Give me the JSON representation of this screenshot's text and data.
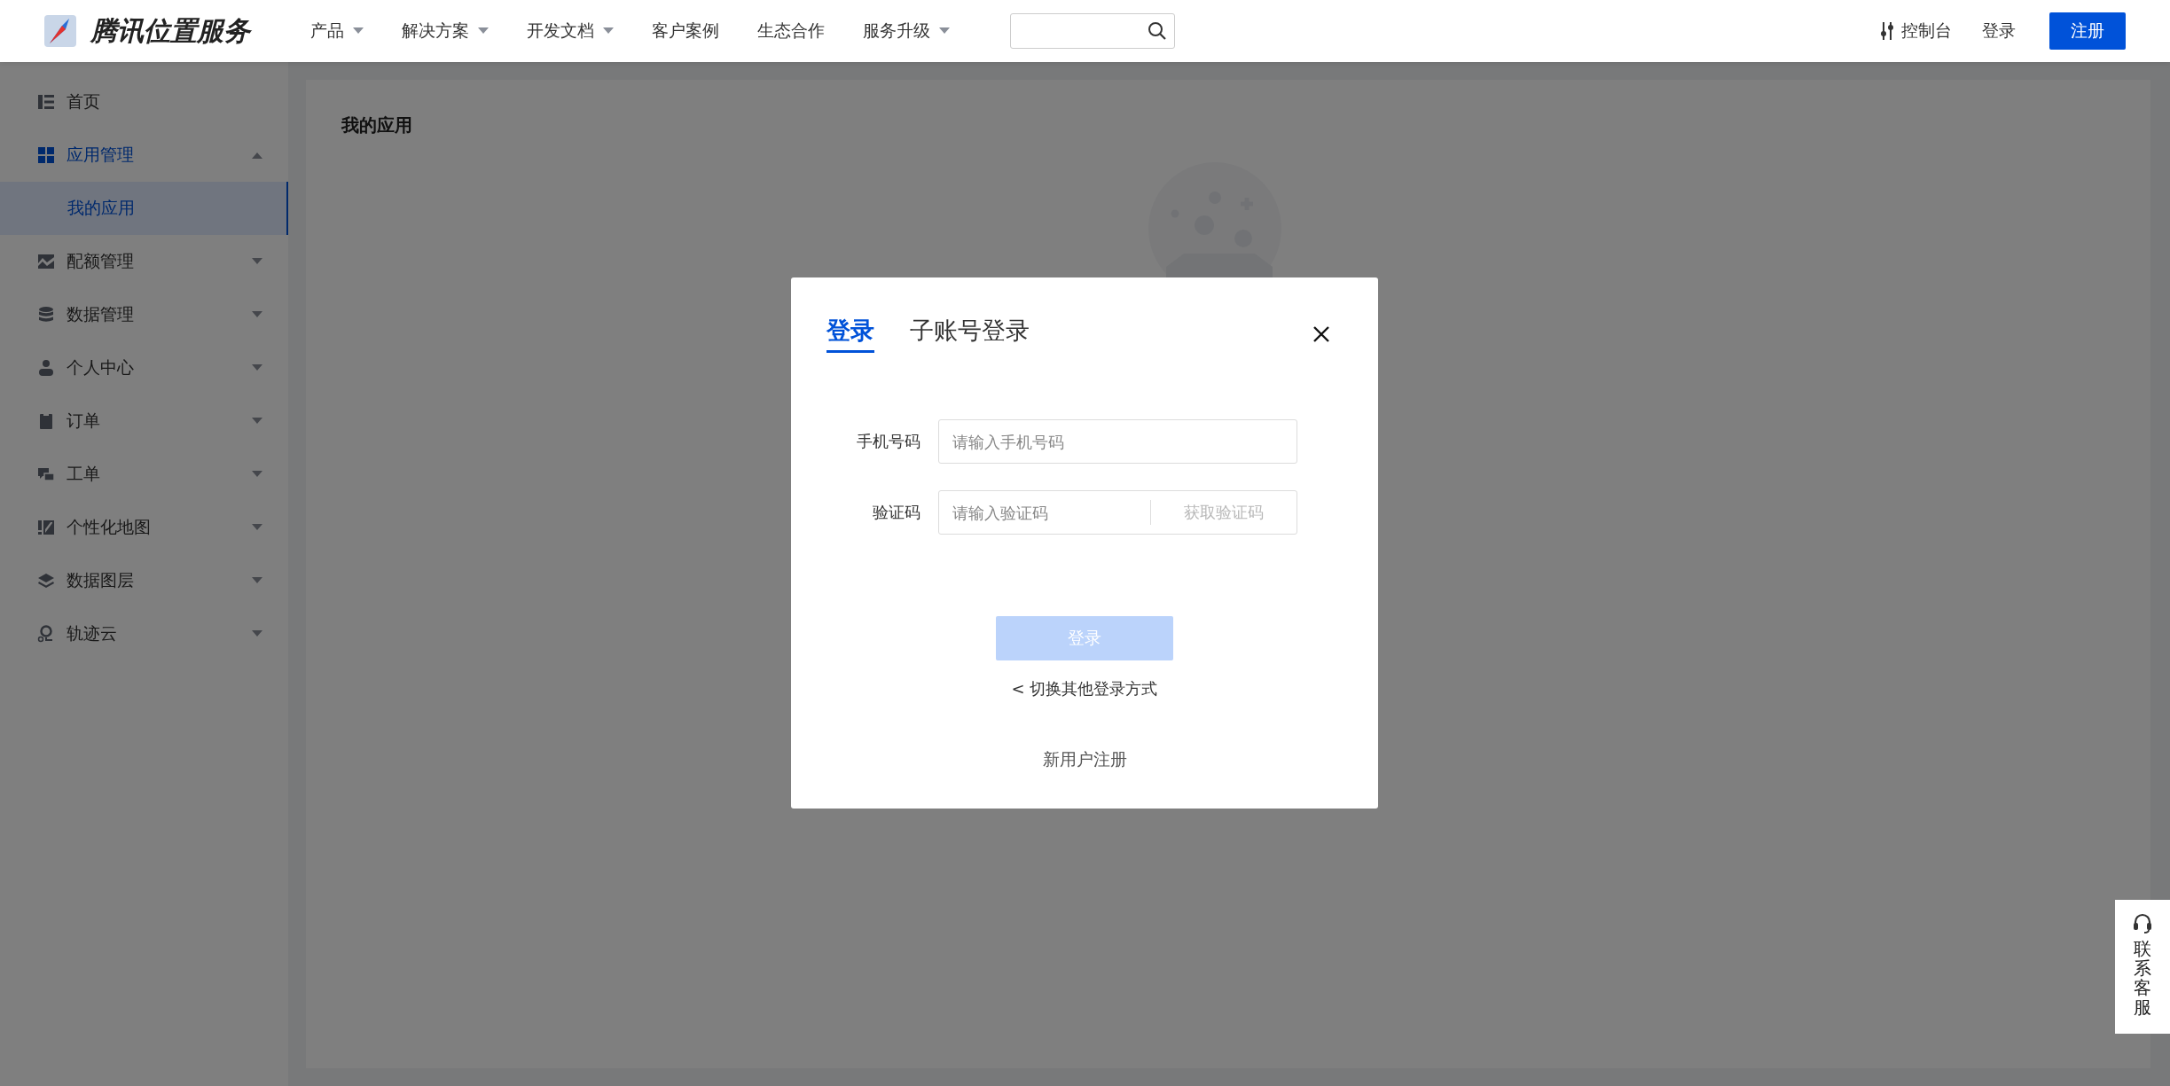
{
  "header": {
    "logo_text": "腾讯位置服务",
    "nav": [
      {
        "label": "产品",
        "has_dropdown": true
      },
      {
        "label": "解决方案",
        "has_dropdown": true
      },
      {
        "label": "开发文档",
        "has_dropdown": true
      },
      {
        "label": "客户案例",
        "has_dropdown": false
      },
      {
        "label": "生态合作",
        "has_dropdown": false
      },
      {
        "label": "服务升级",
        "has_dropdown": true
      }
    ],
    "console": "控制台",
    "login": "登录",
    "register": "注册"
  },
  "sidebar": {
    "items": [
      {
        "label": "首页"
      },
      {
        "label": "应用管理",
        "expanded": true,
        "children": [
          {
            "label": "我的应用",
            "selected": true
          }
        ]
      },
      {
        "label": "配额管理",
        "expanded": false
      },
      {
        "label": "数据管理",
        "expanded": false
      },
      {
        "label": "个人中心",
        "expanded": false
      },
      {
        "label": "订单",
        "expanded": false
      },
      {
        "label": "工单",
        "expanded": false
      },
      {
        "label": "个性化地图",
        "expanded": false
      },
      {
        "label": "数据图层",
        "expanded": false
      },
      {
        "label": "轨迹云",
        "expanded": false
      }
    ]
  },
  "content": {
    "title": "我的应用"
  },
  "modal": {
    "tabs": [
      {
        "label": "登录",
        "selected": true
      },
      {
        "label": "子账号登录",
        "selected": false
      }
    ],
    "fields": [
      {
        "kind": "text",
        "label": "手机号码",
        "placeholder": "请输入手机号码"
      },
      {
        "kind": "code",
        "label": "验证码",
        "placeholder": "请输入验证码",
        "action": "获取验证码"
      }
    ],
    "submit": {
      "label": "登录",
      "disabled": true
    },
    "switch_link": "< 切换其他登录方式",
    "register_link": "新用户注册"
  },
  "contact": {
    "label": "联系客服"
  }
}
